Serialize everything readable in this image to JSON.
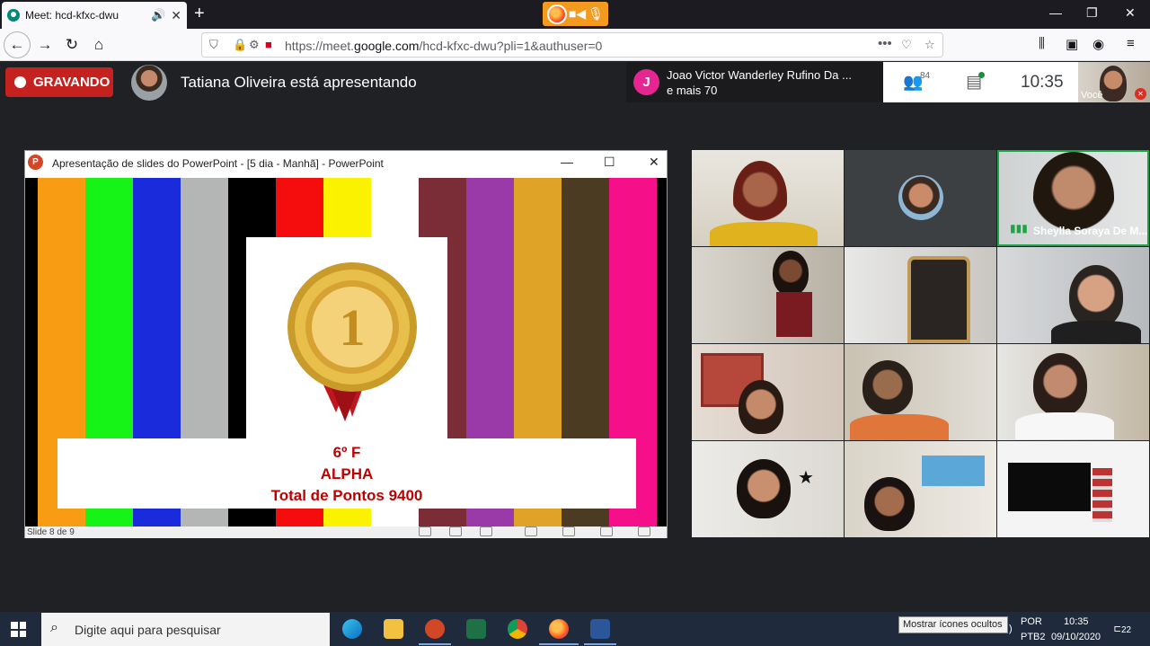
{
  "browser": {
    "tab_title": "Meet: hcd-kfxc-dwu",
    "new_tab": "+",
    "url_host_prefix": "https://meet.",
    "url_host": "google.com",
    "url_path": "/hcd-kfxc-dwu?pli=1&authuser=0"
  },
  "meet": {
    "recording_label": "GRAVANDO",
    "presenter_text": "Tatiana Oliveira está apresentando",
    "join_notice_initial": "J",
    "join_notice_line1": "Joao Victor Wanderley Rufino Da ...",
    "join_notice_line2": "e mais 70",
    "participant_count": "84",
    "clock": "10:35",
    "self_label": "Você",
    "speaking_name": "Sheylla Soraya De M..."
  },
  "ppt": {
    "window_title": "Apresentação de slides do PowerPoint - [5 dia - Manhã] - PowerPoint",
    "slide_status": "Slide 8 de 9",
    "slide_line1": "6º F",
    "slide_line2": "ALPHA",
    "slide_line3": "Total de Pontos 9400",
    "bar_colors": [
      "#f89d13",
      "#16f316",
      "#1a2bdc",
      "#b3b6b4",
      "#000000",
      "#f50d0d",
      "#fbf200",
      "#ffffff",
      "#7b2d37",
      "#9a3aa8",
      "#dea327",
      "#4a3b22",
      "#f5108a"
    ]
  },
  "taskbar": {
    "search_placeholder": "Digite aqui para pesquisar",
    "tooltip": "Mostrar ícones ocultos",
    "lang_top": "POR",
    "lang_bottom": "PTB2",
    "time": "10:35",
    "date": "09/10/2020",
    "notifications": "22"
  },
  "colors": {
    "recording_red": "#c5221f",
    "join_avatar": "#e52592",
    "meet_bg": "#202124"
  }
}
